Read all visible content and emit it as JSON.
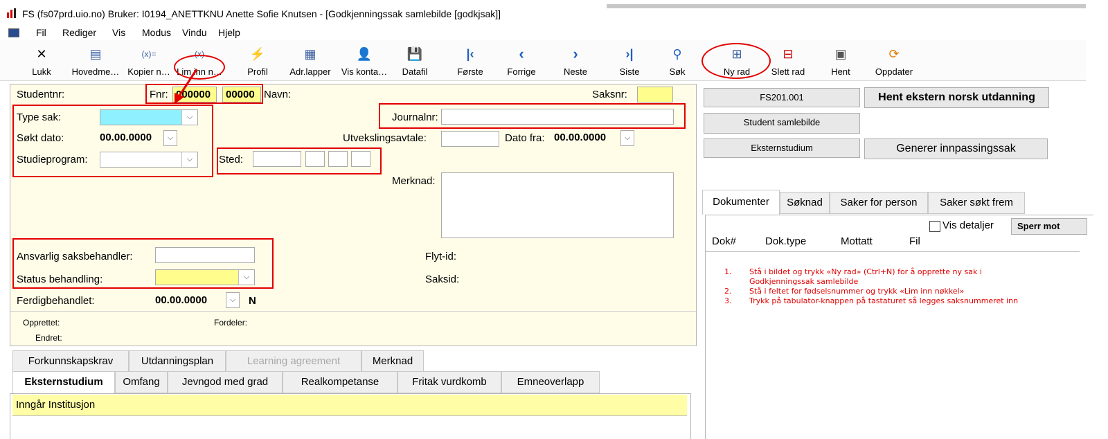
{
  "window": {
    "title": "FS (fs07prd.uio.no) Bruker: I0194_ANETTKNU Anette Sofie Knutsen - [Godkjenningssak samlebilde  [godkjsak]]"
  },
  "menu": [
    "Fil",
    "Rediger",
    "Vis",
    "Modus",
    "Vindu",
    "Hjelp"
  ],
  "toolbar": [
    {
      "label": "Lukk",
      "icon": "close-icon",
      "glyph": "✕"
    },
    {
      "label": "Hovedme…",
      "icon": "main-menu-icon",
      "glyph": "▤"
    },
    {
      "label": "Kopier n…",
      "icon": "copy-key-icon",
      "glyph": "(x)="
    },
    {
      "label": "Lim inn n…",
      "icon": "paste-key-icon",
      "glyph": "(x)"
    },
    {
      "label": "Profil",
      "icon": "lightning-icon",
      "glyph": "⚡"
    },
    {
      "label": "Adr.lapper",
      "icon": "labels-icon",
      "glyph": "▦"
    },
    {
      "label": "Vis konta…",
      "icon": "contact-icon",
      "glyph": "👤"
    },
    {
      "label": "Datafil",
      "icon": "save-icon",
      "glyph": "💾"
    },
    {
      "label": "Første",
      "icon": "first-icon",
      "glyph": "|‹"
    },
    {
      "label": "Forrige",
      "icon": "previous-icon",
      "glyph": "‹"
    },
    {
      "label": "Neste",
      "icon": "next-icon",
      "glyph": "›"
    },
    {
      "label": "Siste",
      "icon": "last-icon",
      "glyph": "›|"
    },
    {
      "label": "Søk",
      "icon": "search-icon",
      "glyph": "⚲"
    },
    {
      "label": "Ny rad",
      "icon": "new-row-icon",
      "glyph": "⊞"
    },
    {
      "label": "Slett rad",
      "icon": "delete-row-icon",
      "glyph": "⊟"
    },
    {
      "label": "Hent",
      "icon": "fetch-icon",
      "glyph": "▣"
    },
    {
      "label": "Oppdater",
      "icon": "refresh-icon",
      "glyph": "⟳"
    }
  ],
  "form": {
    "studentnr_label": "Studentnr:",
    "fnr_label": "Fnr:",
    "fnr_value1": "000000",
    "fnr_value2": "00000",
    "navn_label": "Navn:",
    "saksnr_label": "Saksnr:",
    "type_sak_label": "Type sak:",
    "journalnr_label": "Journalnr:",
    "sokt_dato_label": "Søkt dato:",
    "sokt_dato_value": "00.00.0000",
    "utvekslingsavtale_label": "Utvekslingsavtale:",
    "dato_fra_label": "Dato fra:",
    "dato_fra_value": "00.00.0000",
    "studieprogram_label": "Studieprogram:",
    "sted_label": "Sted:",
    "merknad_label": "Merknad:",
    "ansvarlig_label": "Ansvarlig saksbehandler:",
    "flyt_id_label": "Flyt-id:",
    "status_label": "Status behandling:",
    "saksid_label": "Saksid:",
    "ferdig_label": "Ferdigbehandlet:",
    "ferdig_value": "00.00.0000",
    "ferdig_flag": "N",
    "opprettet_label": "Opprettet:",
    "fordeler_label": "Fordeler:",
    "endret_label": "Endret:"
  },
  "tabs_row1": [
    "Forkunnskapskrav",
    "Utdanningsplan",
    "Learning agreement",
    "Merknad"
  ],
  "tabs_row2": [
    "Eksternstudium",
    "Omfang",
    "Jevngod med grad",
    "Realkompetanse",
    "Fritak vurdkomb",
    "Emneoverlapp"
  ],
  "subpanel": {
    "header": "Inngår Institusjon"
  },
  "right_buttons": {
    "fs201": "FS201.001",
    "hent_ekstern": "Hent ekstern norsk utdanning",
    "student_samlebilde": "Student samlebilde",
    "eksternstudium": "Eksternstudium",
    "generer": "Generer innpassingssak"
  },
  "right_tabs": [
    "Dokumenter",
    "Søknad",
    "Saker for person",
    "Saker søkt frem"
  ],
  "documents": {
    "vis_detaljer": "Vis detaljer",
    "sperr": "Sperr mot",
    "columns": [
      "Dok#",
      "Dok.type",
      "Mottatt",
      "Fil"
    ]
  },
  "instructions": [
    {
      "num": "1.",
      "text": "Stå i bildet og trykk «Ny rad» (Ctrl+N) for å opprette ny sak i",
      "text2": "Godkjenningssak samlebilde"
    },
    {
      "num": "2.",
      "text": "Stå i feltet for fødselsnummer og trykk «Lim inn nøkkel»"
    },
    {
      "num": "3.",
      "text": "Trykk på tabulator-knappen på tastaturet så legges saksnummeret inn"
    }
  ],
  "colors": {
    "annotation_red": "#e20000",
    "field_yellow": "#fffe8c",
    "field_cyan": "#8ff0ff",
    "form_bg": "#fffde8"
  }
}
